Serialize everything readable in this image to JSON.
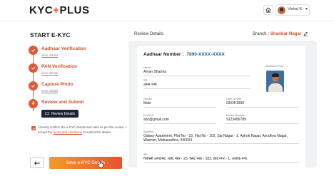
{
  "header": {
    "logo_prefix": "KYC",
    "logo_plus": "+",
    "logo_suffix": "PLUS",
    "user_name": "Vishal K.",
    "user_chevron": "▾"
  },
  "left": {
    "title": "START E-KYC",
    "steps": [
      {
        "title": "Aadhaar Verification",
        "link": "view details",
        "icon": "check-icon"
      },
      {
        "title": "PAN Verification",
        "link": "view details",
        "icon": "check-icon"
      },
      {
        "title": "Capture Photo",
        "link": "view details",
        "icon": "check-icon"
      },
      {
        "title": "Review and Submit",
        "number": "4"
      }
    ],
    "review_button": "Review Details",
    "confirm_text_before": "I hereby confirm the e-KYC details and valid as per the review. I accept the ",
    "confirm_terms": "terms and conditions",
    "confirm_text_after": " to submit the details.",
    "save_button": "Save e-KYC Details"
  },
  "right": {
    "title": "Review Details",
    "branch_label": "Branch : ",
    "branch_name": "Shankar Nagar",
    "aadhaar_label": "Aadhaar Number :",
    "aadhaar_value": "7890-XXXX-XXXX",
    "photo_label": "Aadhaar Photo",
    "fields": {
      "name": {
        "label": "Name",
        "value": "Aman Sharma"
      },
      "name_local": {
        "label": "नाम",
        "value": "अमन शर्मा"
      },
      "gender": {
        "label": "Gender",
        "value": "Male"
      },
      "dob": {
        "label": "Date of Birth",
        "value": "03/04/1990"
      },
      "email": {
        "label": "Email ID",
        "value": "abc@gmail.com"
      },
      "mobile": {
        "label": "Mobile Number",
        "value": "9123456789"
      },
      "address": {
        "label": "Address",
        "value": "Galaxy Apartment, Plot No - 23, Flat No - 102, Sai Nagar - 1, Ashok Nagar, Ayodhya Nagar, Washim, Maharasthra, 440024"
      },
      "address_local": {
        "label": "पता",
        "value": "गैलेक्सी अपार्टमेंट, प्लॉट नंबर - 23, फ्लैट नंबर - 102, साई नगर - 1, अशोक नगर,"
      }
    }
  },
  "colors": {
    "accent": "#e05a3a",
    "dark_button": "#1d2333",
    "aadhaar_blue": "#2f5b9a",
    "gradient_start": "#f59a2a",
    "gradient_end": "#e7542e"
  }
}
